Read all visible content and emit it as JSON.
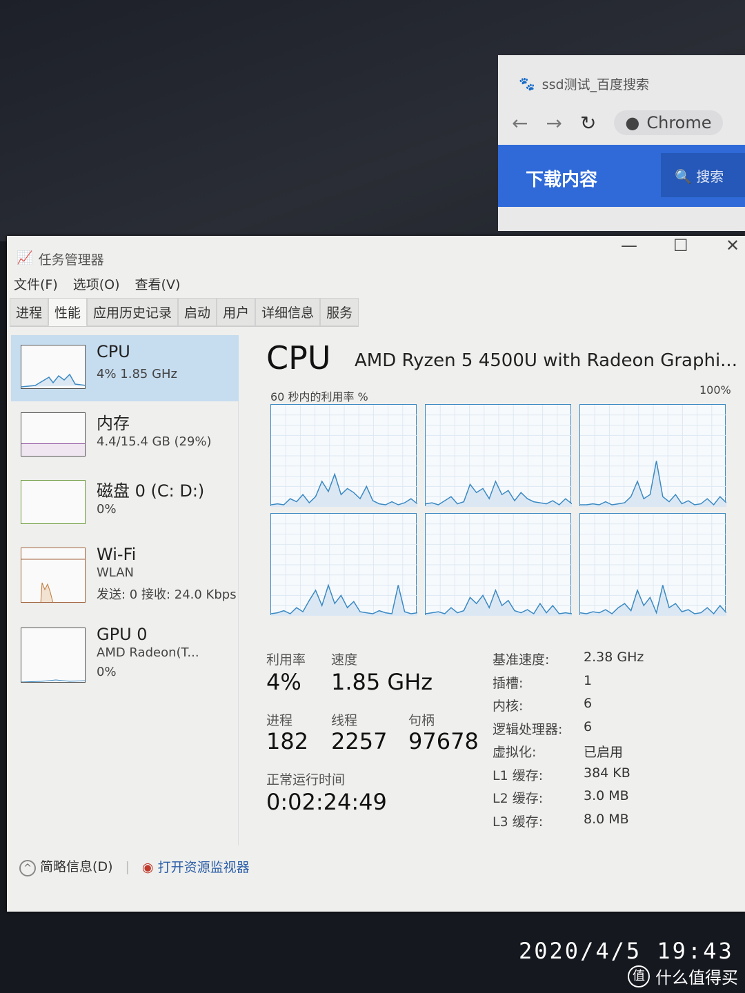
{
  "chrome": {
    "tab_title": "ssd测试_百度搜索",
    "omnibox": "Chrome",
    "download_label": "下载内容",
    "search_label": "搜索"
  },
  "window": {
    "title": "任务管理器",
    "minimize": "—",
    "maximize": "☐",
    "close": "✕",
    "menu": [
      "文件(F)",
      "选项(O)",
      "查看(V)"
    ],
    "tabs": [
      "进程",
      "性能",
      "应用历史记录",
      "启动",
      "用户",
      "详细信息",
      "服务"
    ],
    "active_tab": "性能"
  },
  "sidebar": [
    {
      "name": "CPU",
      "value": "4% 1.85 GHz",
      "selected": true
    },
    {
      "name": "内存",
      "value": "4.4/15.4 GB (29%)"
    },
    {
      "name": "磁盘 0 (C: D:)",
      "value": "0%"
    },
    {
      "name": "Wi-Fi",
      "value": "WLAN",
      "value2": "发送: 0 接收: 24.0 Kbps"
    },
    {
      "name": "GPU 0",
      "value": "AMD Radeon(T...",
      "value2": "0%"
    }
  ],
  "main": {
    "title": "CPU",
    "model": "AMD Ryzen 5 4500U with Radeon Graphi...",
    "util_label": "60 秒内的利用率 %",
    "max_label": "100%",
    "core_graphs": [
      [
        2,
        3,
        2,
        8,
        5,
        12,
        4,
        10,
        25,
        15,
        32,
        12,
        18,
        14,
        8,
        20,
        6,
        3,
        2,
        5,
        2,
        4,
        8,
        3
      ],
      [
        3,
        4,
        2,
        6,
        10,
        3,
        5,
        22,
        14,
        18,
        8,
        25,
        12,
        16,
        6,
        14,
        8,
        5,
        4,
        3,
        6,
        2,
        8,
        3
      ],
      [
        2,
        2,
        3,
        2,
        5,
        2,
        3,
        4,
        10,
        25,
        8,
        12,
        45,
        10,
        5,
        12,
        3,
        6,
        2,
        3,
        8,
        2,
        10,
        4
      ],
      [
        2,
        3,
        5,
        2,
        8,
        4,
        15,
        25,
        10,
        30,
        12,
        20,
        8,
        14,
        4,
        3,
        2,
        5,
        3,
        2,
        30,
        4,
        2,
        3
      ],
      [
        2,
        3,
        4,
        2,
        8,
        3,
        5,
        18,
        12,
        20,
        8,
        25,
        10,
        15,
        5,
        3,
        6,
        2,
        12,
        3,
        10,
        2,
        3,
        2
      ],
      [
        3,
        2,
        4,
        3,
        6,
        2,
        8,
        12,
        5,
        25,
        10,
        18,
        3,
        30,
        8,
        12,
        4,
        6,
        2,
        3,
        8,
        2,
        10,
        3
      ]
    ],
    "color": "#3b89c2",
    "stats": {
      "util_label": "利用率",
      "util": "4%",
      "speed_label": "速度",
      "speed": "1.85 GHz",
      "proc_label": "进程",
      "proc": "182",
      "threads_label": "线程",
      "threads": "2257",
      "handles_label": "句柄",
      "handles": "97678",
      "uptime_label": "正常运行时间",
      "uptime": "0:02:24:49"
    },
    "specs": [
      [
        "基准速度:",
        "2.38 GHz"
      ],
      [
        "插槽:",
        "1"
      ],
      [
        "内核:",
        "6"
      ],
      [
        "逻辑处理器:",
        "6"
      ],
      [
        "虚拟化:",
        "已启用"
      ],
      [
        "L1 缓存:",
        "384 KB"
      ],
      [
        "L2 缓存:",
        "3.0 MB"
      ],
      [
        "L3 缓存:",
        "8.0 MB"
      ]
    ]
  },
  "footer": {
    "less": "简略信息(D)",
    "monitor": "打开资源监视器"
  },
  "photo": {
    "timestamp": "2020/4/5  19:43",
    "watermark": "什么值得买",
    "watermark_icon": "值"
  }
}
